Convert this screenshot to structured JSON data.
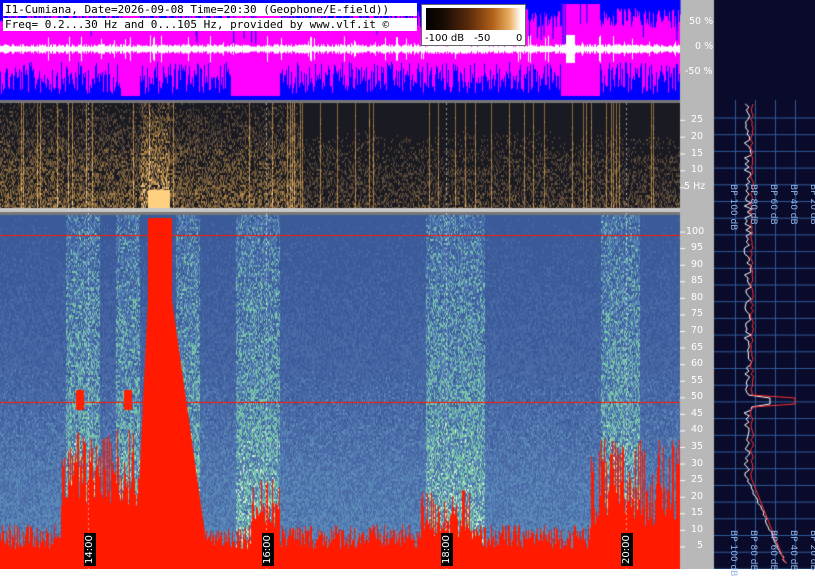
{
  "header": {
    "line1": "I1-Cumiana, Date=2026-09-08 Time=20:30 (Geophone/E-field))",
    "line2": "Freq= 0.2...30 Hz and 0...105 Hz, provided by www.vlf.it ©"
  },
  "legend": {
    "ticks": [
      "-100 dB",
      "-50",
      "0"
    ]
  },
  "time_labels": [
    "14:00",
    "16:00",
    "18:00",
    "20:00"
  ],
  "colors": {
    "waveform_bg": "#ff00ff",
    "waveform_blue": "#0000ff",
    "high_spec_bg": "#3a5a9a",
    "low_spec_bg": "#1a1a22",
    "signal_red": "#ff1a00",
    "right_panel": "#0a0a2a"
  },
  "chart_data": [
    {
      "type": "line",
      "name": "amplitude",
      "ylabel_ticks": [
        "50 %",
        "0 %",
        "-50 %"
      ],
      "ylim": [
        -100,
        100
      ]
    },
    {
      "type": "heatmap",
      "name": "low-frequency spectrogram",
      "y_unit": "Hz",
      "y_ticks": [
        25,
        20,
        15,
        10,
        5
      ],
      "y_tick_labels": [
        "25",
        "20",
        "15",
        "10",
        "5 Hz"
      ],
      "ylim": [
        0.2,
        30
      ],
      "x_ticks": [
        "14:00",
        "16:00",
        "18:00",
        "20:00"
      ]
    },
    {
      "type": "heatmap",
      "name": "high-frequency spectrogram",
      "y_ticks": [
        100,
        95,
        90,
        85,
        80,
        75,
        70,
        65,
        60,
        55,
        50,
        45,
        40,
        35,
        30,
        25,
        20,
        15,
        10,
        5
      ],
      "ylim": [
        0,
        105
      ],
      "x_ticks": [
        "14:00",
        "16:00",
        "18:00",
        "20:00"
      ],
      "lines_at": [
        100,
        50
      ]
    },
    {
      "type": "line",
      "name": "spectrum profile",
      "x_ticks": [
        "-100 dB",
        "-80 dB",
        "-60 dB",
        "-40 dB",
        "-20 dB"
      ],
      "x_tick_labels": [
        "100 dB",
        "80 dB",
        "60 dB",
        "40 dB",
        "20 dB"
      ]
    }
  ]
}
